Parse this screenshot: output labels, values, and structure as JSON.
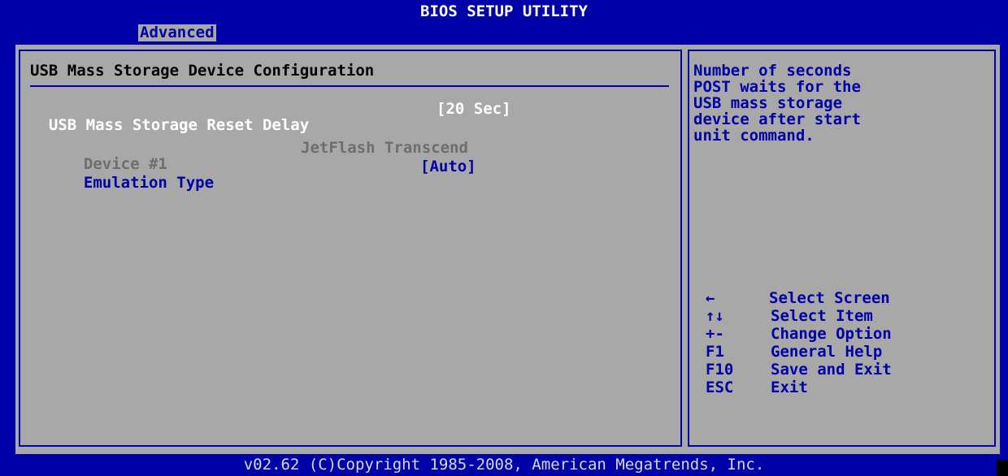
{
  "header": {
    "title": "BIOS SETUP UTILITY",
    "active_tab": "Advanced"
  },
  "main": {
    "section_title": "USB Mass Storage Device Configuration",
    "reset_delay": {
      "label": "USB Mass Storage Reset Delay",
      "value": "[20 Sec]"
    },
    "device": {
      "label": "Device #1",
      "value": "JetFlash Transcend"
    },
    "emulation": {
      "label": "Emulation Type",
      "value": "[Auto]"
    }
  },
  "help": {
    "lines": [
      "Number of seconds",
      "POST waits for the",
      "USB mass storage",
      "device after start",
      "unit command."
    ]
  },
  "keys": [
    {
      "key": "←",
      "desc": "Select Screen"
    },
    {
      "key": "↑↓",
      "desc": "Select Item"
    },
    {
      "key": "+-",
      "desc": "Change Option"
    },
    {
      "key": "F1",
      "desc": "General Help"
    },
    {
      "key": "F10",
      "desc": "Save and Exit"
    },
    {
      "key": "ESC",
      "desc": "Exit"
    }
  ],
  "footer": {
    "copyright": "v02.62 (C)Copyright 1985-2008, American Megatrends, Inc."
  },
  "colors": {
    "background": "#0000a8",
    "panel": "#a8a8a8",
    "highlight_text": "#ffffff",
    "disabled_text": "#6e6e6e"
  }
}
